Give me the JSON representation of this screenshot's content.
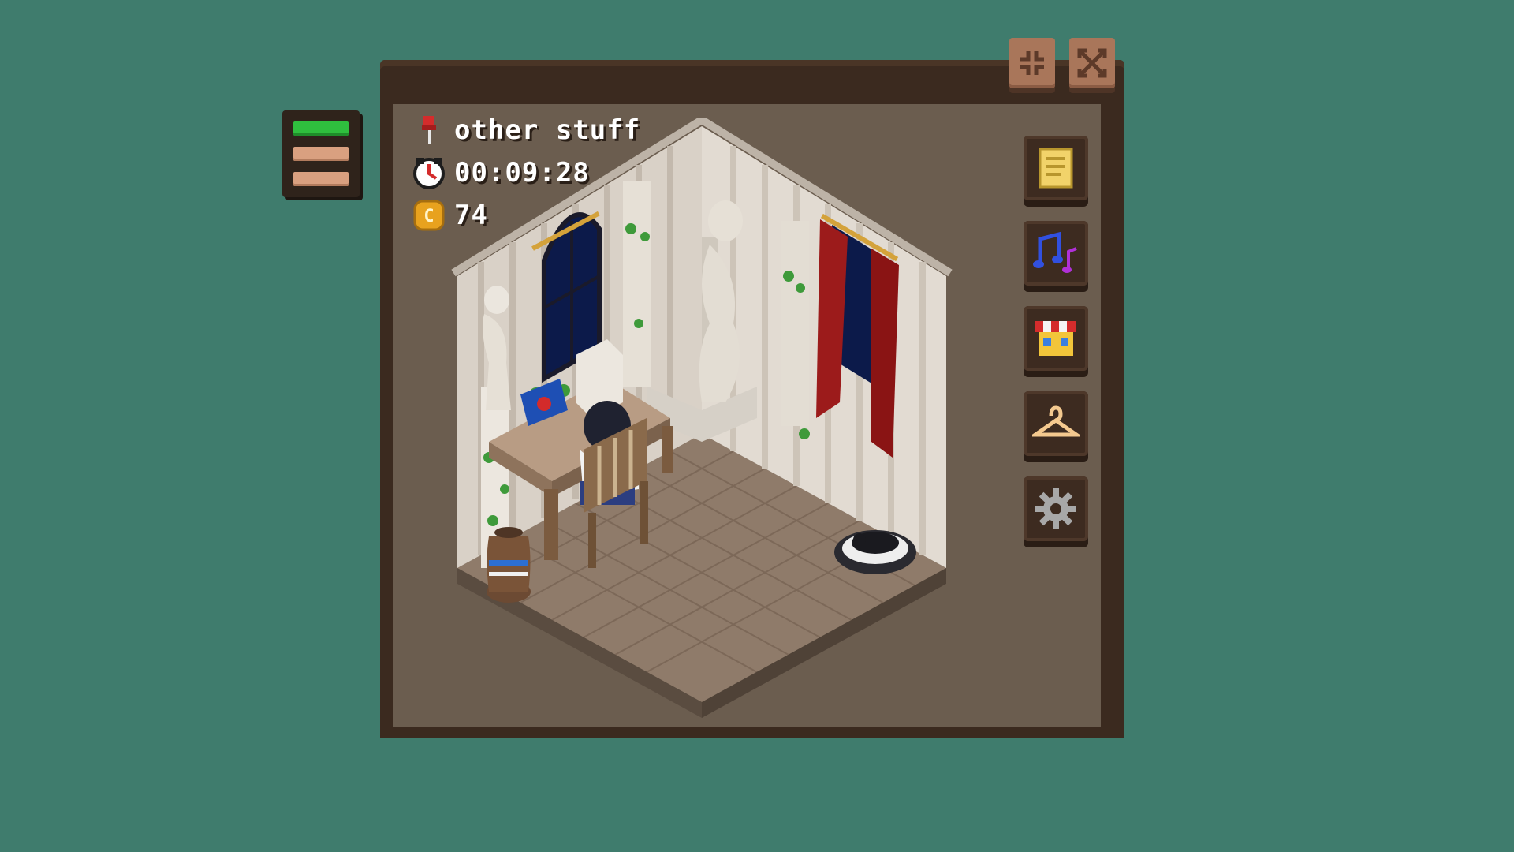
{
  "app": {
    "task_name": "other stuff",
    "timer": "00:09:28",
    "coins": "74"
  },
  "icons": {
    "pin": "pushpin-icon",
    "clock": "clock-icon",
    "coin": "coin-icon",
    "expand": "expand-icon",
    "close": "close-icon"
  },
  "sidebar": [
    {
      "name": "notes-button",
      "icon": "notepad-icon"
    },
    {
      "name": "music-button",
      "icon": "music-note-icon"
    },
    {
      "name": "shop-button",
      "icon": "shop-icon"
    },
    {
      "name": "wardrobe-button",
      "icon": "hanger-icon"
    },
    {
      "name": "settings-button",
      "icon": "gear-icon"
    }
  ],
  "colors": {
    "background": "#3f7c6d",
    "window_frame": "#3b2a1f",
    "window_inner": "#6b5d4f",
    "progress_active": "#2fbf3e",
    "progress_idle": "#d9a080",
    "text": "#ffffff"
  }
}
